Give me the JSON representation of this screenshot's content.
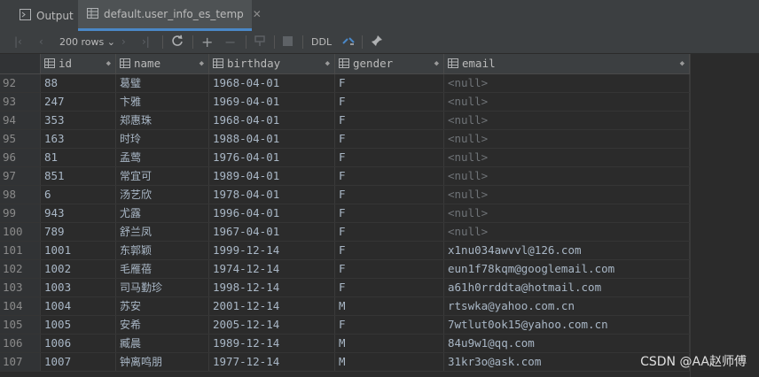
{
  "tabs": [
    {
      "label": "Output",
      "icon": "output-icon",
      "active": false
    },
    {
      "label": "default.user_info_es_temp",
      "icon": "table-icon",
      "active": true
    }
  ],
  "toolbar": {
    "rows_label": "200 rows",
    "ddl_label": "DDL"
  },
  "columns": [
    {
      "label": "id"
    },
    {
      "label": "name"
    },
    {
      "label": "birthday"
    },
    {
      "label": "gender"
    },
    {
      "label": "email"
    }
  ],
  "rows": [
    {
      "num": "92",
      "id": "88",
      "name": "葛璧",
      "birthday": "1968-04-01",
      "gender": "F",
      "email": "<null>"
    },
    {
      "num": "93",
      "id": "247",
      "name": "卞雅",
      "birthday": "1969-04-01",
      "gender": "F",
      "email": "<null>"
    },
    {
      "num": "94",
      "id": "353",
      "name": "郑惠珠",
      "birthday": "1968-04-01",
      "gender": "F",
      "email": "<null>"
    },
    {
      "num": "95",
      "id": "163",
      "name": "时玲",
      "birthday": "1988-04-01",
      "gender": "F",
      "email": "<null>"
    },
    {
      "num": "96",
      "id": "81",
      "name": "孟莺",
      "birthday": "1976-04-01",
      "gender": "F",
      "email": "<null>"
    },
    {
      "num": "97",
      "id": "851",
      "name": "常宜可",
      "birthday": "1989-04-01",
      "gender": "F",
      "email": "<null>"
    },
    {
      "num": "98",
      "id": "6",
      "name": "汤艺欣",
      "birthday": "1978-04-01",
      "gender": "F",
      "email": "<null>"
    },
    {
      "num": "99",
      "id": "943",
      "name": "尤露",
      "birthday": "1996-04-01",
      "gender": "F",
      "email": "<null>"
    },
    {
      "num": "100",
      "id": "789",
      "name": "舒兰凤",
      "birthday": "1967-04-01",
      "gender": "F",
      "email": "<null>"
    },
    {
      "num": "101",
      "id": "1001",
      "name": "东郭颖",
      "birthday": "1999-12-14",
      "gender": "F",
      "email": "x1nu034awvvl@126.com"
    },
    {
      "num": "102",
      "id": "1002",
      "name": "毛雁蓓",
      "birthday": "1974-12-14",
      "gender": "F",
      "email": "eun1f78kqm@googlemail.com"
    },
    {
      "num": "103",
      "id": "1003",
      "name": "司马勤珍",
      "birthday": "1998-12-14",
      "gender": "F",
      "email": "a61h0rrddta@hotmail.com"
    },
    {
      "num": "104",
      "id": "1004",
      "name": "苏安",
      "birthday": "2001-12-14",
      "gender": "M",
      "email": "rtswka@yahoo.com.cn"
    },
    {
      "num": "105",
      "id": "1005",
      "name": "安希",
      "birthday": "2005-12-14",
      "gender": "F",
      "email": "7wtlut0ok15@yahoo.com.cn"
    },
    {
      "num": "106",
      "id": "1006",
      "name": "臧晨",
      "birthday": "1989-12-14",
      "gender": "M",
      "email": "84u9w1@qq.com"
    },
    {
      "num": "107",
      "id": "1007",
      "name": "钟离鸣朋",
      "birthday": "1977-12-14",
      "gender": "M",
      "email": "31kr3o@ask.com"
    }
  ],
  "watermark": "CSDN @AA赵师傅",
  "colors": {
    "accent": "#4a88c7",
    "background": "#2b2b2b",
    "header": "#3c3f41",
    "null_text": "#6f7377"
  }
}
